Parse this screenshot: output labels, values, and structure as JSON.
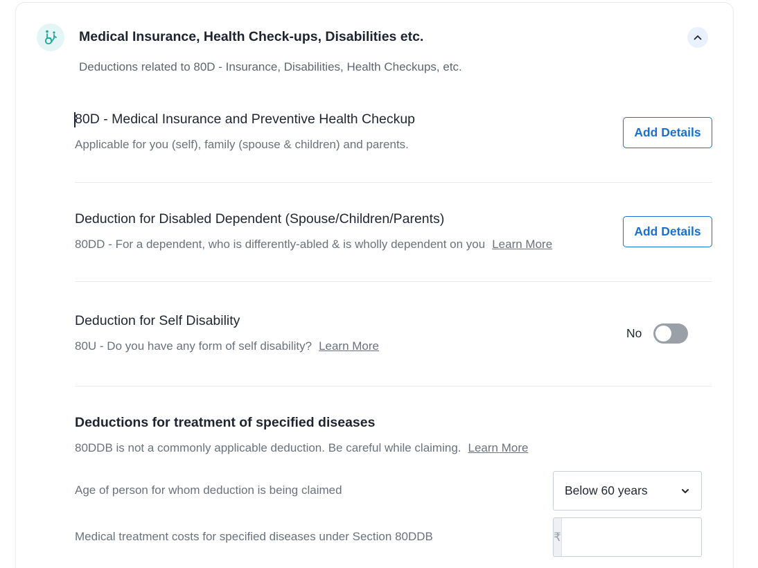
{
  "header": {
    "title": "Medical Insurance, Health Check-ups, Disabilities etc.",
    "subtitle": "Deductions related to 80D - Insurance, Disabilities, Health Checkups, etc.",
    "icon": "wheelchair-person-icon",
    "collapse_icon": "chevron-up-icon",
    "accent": "#1aa6a0"
  },
  "sections": [
    {
      "title": "80D - Medical Insurance and Preventive Health Checkup",
      "description": "Applicable for you (self), family (spouse & children) and parents.",
      "button": "Add Details"
    },
    {
      "title": "Deduction for Disabled Dependent (Spouse/Children/Parents)",
      "description": "80DD - For a dependent, who is differently-abled & is wholly dependent on you",
      "learn_more": "Learn More",
      "button": "Add Details"
    },
    {
      "title": "Deduction for Self Disability",
      "description": "80U - Do you have any form of self disability?",
      "learn_more": "Learn More",
      "toggle_label": "No",
      "toggle_on": false
    },
    {
      "title": "Deductions for treatment of specified diseases",
      "description": "80DDB is not a commonly applicable deduction. Be careful while claiming.",
      "learn_more": "Learn More",
      "fields": [
        {
          "label": "Age of person for whom deduction is being claimed",
          "value": "Below 60 years"
        },
        {
          "label": "Medical treatment costs for specified diseases under Section 80DDB",
          "prefix": "₹",
          "value": ""
        }
      ]
    }
  ],
  "colors": {
    "primary": "#1a6fd0",
    "toggle_off": "#9aa0a8"
  }
}
